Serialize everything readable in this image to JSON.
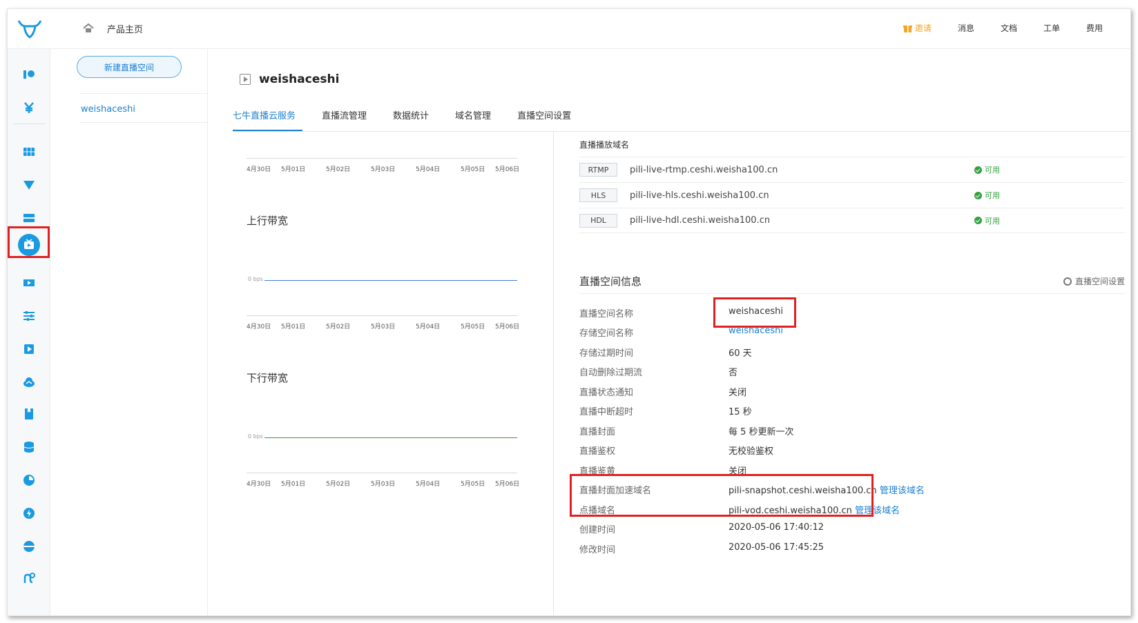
{
  "header": {
    "home_label": "产品主页",
    "invite": "邀请",
    "messages": "消息",
    "docs": "文档",
    "tickets": "工单",
    "billing": "费用"
  },
  "sidebar": {
    "new_space_button": "新建直播空间",
    "spaces": [
      "weishaceshi"
    ]
  },
  "page": {
    "title": "weishaceshi",
    "tabs": [
      "七牛直播云服务",
      "直播流管理",
      "数据统计",
      "域名管理",
      "直播空间设置"
    ],
    "active_tab": 0
  },
  "charts": {
    "x_labels": [
      "4月30日",
      "5月01日",
      "5月02日",
      "5月03日",
      "5月04日",
      "5月05日",
      "5月06日"
    ],
    "upstream_title": "上行带宽",
    "downstream_title": "下行带宽",
    "zero_label": "0 bps",
    "upstream_color": "#3a7bd5",
    "downstream_color": "#33a040"
  },
  "chart_data": [
    {
      "type": "line",
      "title": "上行带宽",
      "xlabel": "",
      "ylabel": "",
      "x": [
        "4月30日",
        "5月01日",
        "5月02日",
        "5月03日",
        "5月04日",
        "5月05日",
        "5月06日"
      ],
      "series": [
        {
          "values": [
            0,
            0,
            0,
            0,
            0,
            0,
            0
          ]
        }
      ],
      "ytick_labels": [
        "0 bps"
      ]
    },
    {
      "type": "line",
      "title": "下行带宽",
      "xlabel": "",
      "ylabel": "",
      "x": [
        "4月30日",
        "5月01日",
        "5月02日",
        "5月03日",
        "5月04日",
        "5月05日",
        "5月06日"
      ],
      "series": [
        {
          "values": [
            0,
            0,
            0,
            0,
            0,
            0,
            0
          ]
        }
      ],
      "ytick_labels": [
        "0 bps"
      ]
    }
  ],
  "play_domains": {
    "heading": "直播播放域名",
    "rows": [
      {
        "protocol": "RTMP",
        "domain": "pili-live-rtmp.ceshi.weisha100.cn",
        "status": "可用"
      },
      {
        "protocol": "HLS",
        "domain": "pili-live-hls.ceshi.weisha100.cn",
        "status": "可用"
      },
      {
        "protocol": "HDL",
        "domain": "pili-live-hdl.ceshi.weisha100.cn",
        "status": "可用"
      }
    ]
  },
  "space_info": {
    "title": "直播空间信息",
    "settings_link": "直播空间设置",
    "manage_link": "管理该域名",
    "rows": [
      {
        "key": "直播空间名称",
        "value": "weishaceshi"
      },
      {
        "key": "存储空间名称",
        "value": "weishaceshi"
      },
      {
        "key": "存储过期时间",
        "value": "60 天"
      },
      {
        "key": "自动删除过期流",
        "value": "否"
      },
      {
        "key": "直播状态通知",
        "value": "关闭"
      },
      {
        "key": "直播中断超时",
        "value": "15 秒"
      },
      {
        "key": "直播封面",
        "value": "每 5 秒更新一次"
      },
      {
        "key": "直播鉴权",
        "value": "无校验鉴权"
      },
      {
        "key": "直播鉴黄",
        "value": "关闭"
      },
      {
        "key": "直播封面加速域名",
        "value": "pili-snapshot.ceshi.weisha100.cn"
      },
      {
        "key": "点播域名",
        "value": "pili-vod.ceshi.weisha100.cn"
      },
      {
        "key": "创建时间",
        "value": "2020-05-06 17:40:12"
      },
      {
        "key": "修改时间",
        "value": "2020-05-06 17:45:25"
      }
    ]
  },
  "colors": {
    "accent": "#1a7fd0",
    "highlight_box": "#e02020",
    "success": "#33a040",
    "invite": "#f5a623"
  }
}
